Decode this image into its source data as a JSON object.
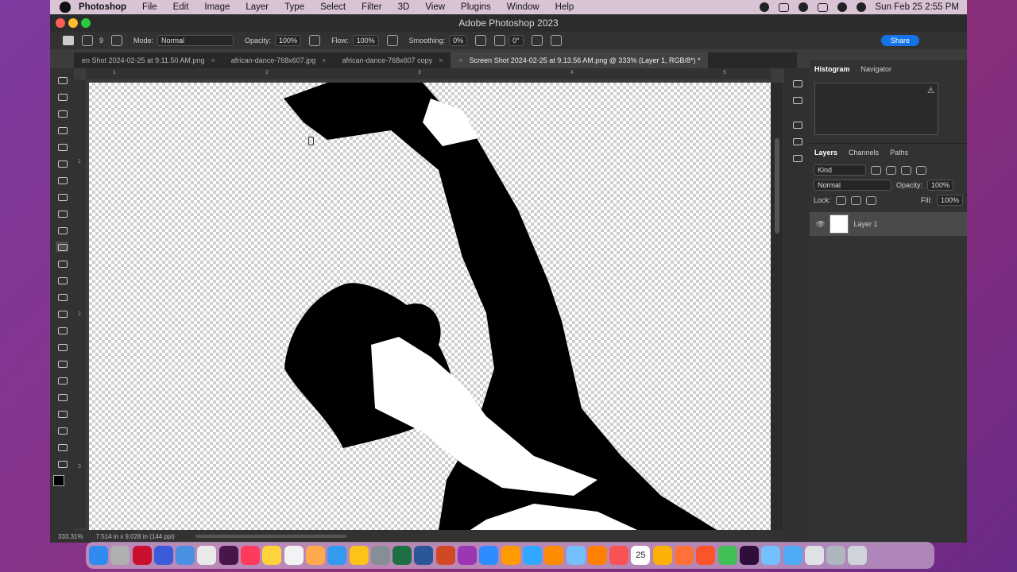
{
  "menubar": {
    "app": "Photoshop",
    "items": [
      "File",
      "Edit",
      "Image",
      "Layer",
      "Type",
      "Select",
      "Filter",
      "3D",
      "View",
      "Plugins",
      "Window",
      "Help"
    ],
    "clock": "Sun Feb 25  2:55 PM"
  },
  "window": {
    "title": "Adobe Photoshop 2023"
  },
  "options": {
    "brush_size": "9",
    "mode_label": "Mode:",
    "mode_value": "Normal",
    "opacity_label": "Opacity:",
    "opacity_value": "100%",
    "flow_label": "Flow:",
    "flow_value": "100%",
    "smoothing_label": "Smoothing:",
    "smoothing_value": "0%",
    "angle_value": "0°",
    "share_label": "Share"
  },
  "tabs": [
    {
      "label": "en Shot 2024-02-25 at 9.11.50 AM.png"
    },
    {
      "label": "african-dance-768x607.jpg"
    },
    {
      "label": "african-dance-768x607 copy"
    },
    {
      "label": "Screen Shot 2024-02-25 at 9.13.56 AM.png @ 333% (Layer 1, RGB/8*) *"
    }
  ],
  "ruler": {
    "top_ticks": [
      "1",
      "2",
      "3",
      "4",
      "5"
    ],
    "left_ticks": [
      "1",
      "2",
      "3"
    ]
  },
  "status": {
    "zoom": "333.31%",
    "doc_info": "7.514 in x 9.028 in (144 ppi)"
  },
  "panels": {
    "top_tabs": [
      "Histogram",
      "Navigator"
    ],
    "layer_tabs": [
      "Layers",
      "Channels",
      "Paths"
    ],
    "filter_kind": "Kind",
    "blend_mode": "Normal",
    "opacity_label": "Opacity:",
    "opacity_value": "100%",
    "lock_label": "Lock:",
    "fill_label": "Fill:",
    "fill_value": "100%",
    "layer_name": "Layer 1"
  },
  "colors": {
    "accent": "#1473e6",
    "panel_bg": "#323232",
    "dock_bg": "#e1d2e6"
  },
  "dock": {
    "icons": [
      "finder-icon",
      "launchpad-icon",
      "acrobat-icon",
      "quicktime-icon",
      "mail-icon",
      "grid-icon",
      "slack-icon",
      "news-icon",
      "notes-icon",
      "reminders-icon",
      "pages-icon",
      "safari-icon",
      "photos-icon",
      "settings-icon",
      "excel-icon",
      "word-icon",
      "powerpoint-icon",
      "podcasts-icon",
      "zoom-icon",
      "illustrator-icon",
      "photoshop-icon",
      "books-icon",
      "preview-icon",
      "vlc-icon",
      "music-icon",
      "calendar-icon",
      "chrome-icon",
      "firefox-icon",
      "brave-icon",
      "android-icon",
      "audition-icon",
      "folder-icon",
      "help-icon",
      "finder-window-icon",
      "keyboard-icon",
      "trash-icon"
    ],
    "calendar_day": "25"
  }
}
